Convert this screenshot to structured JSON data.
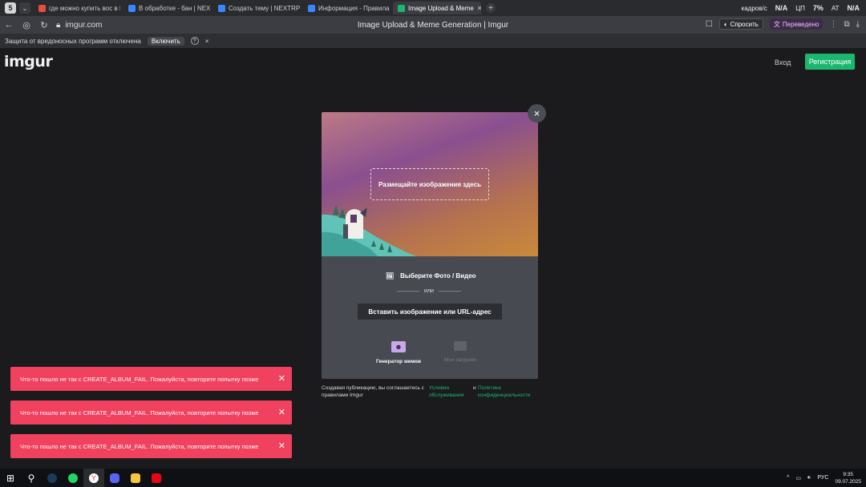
{
  "browser": {
    "tab_counter": "5",
    "tabs": [
      {
        "label": "где можно купить вос в N",
        "fav_color": "#e84c3d",
        "active": false
      },
      {
        "label": "В обработке - бан | NEXT",
        "fav_color": "#3a86ff",
        "active": false
      },
      {
        "label": "Создать тему | NEXTRP",
        "fav_color": "#3a86ff",
        "active": false
      },
      {
        "label": "Информация - Правила п",
        "fav_color": "#3a86ff",
        "active": false
      },
      {
        "label": "Image Upload & Meme",
        "fav_color": "#1bb76e",
        "active": true
      }
    ],
    "new_tab": "+",
    "tray_fps_label": "кадров/с",
    "tray_fps_value": "N/A",
    "tray_cpu": "ЦП",
    "tray_temp": "7%",
    "tray_gpu_label": "АТ",
    "tray_gpu_value": "N/A",
    "url": "imgur.com",
    "page_title": "Image Upload & Meme Generation | Imgur",
    "ask_label": "Спросить",
    "translated_label": "Переведено"
  },
  "malware_bar": {
    "text": "Защита от вредоносных программ отключена",
    "enable": "Включить",
    "help": "?",
    "close": "×"
  },
  "header": {
    "logo": "imgur",
    "login": "Вход",
    "register": "Регистрация"
  },
  "modal": {
    "dropzone": "Размещайте изображения здесь",
    "choose": "Выберите Фото / Видео",
    "or": "или",
    "paste": "Вставить изображение или URL-адрес",
    "meme_generator": "Генератор мемов",
    "my_uploads": "Мои загрузки",
    "close": "×"
  },
  "terms": {
    "text": "Создавая публикацию, вы соглашаетесь с правилами Imgur",
    "link1": "Условия обслуживания",
    "and": "и",
    "link2": "Политика конфиденциальности"
  },
  "toasts": [
    "Что-то пошло не так с CREATE_ALBUM_FAIL. Пожалуйста, повторите попытку позже",
    "Что-то пошло не так с CREATE_ALBUM_FAIL. Пожалуйста, повторите попытку позже",
    "Что-то пошло не так с CREATE_ALBUM_FAIL. Пожалуйста, повторите попытку позже"
  ],
  "taskbar": {
    "lang": "РУС",
    "time": "9:35",
    "date": "09.07.2025"
  }
}
